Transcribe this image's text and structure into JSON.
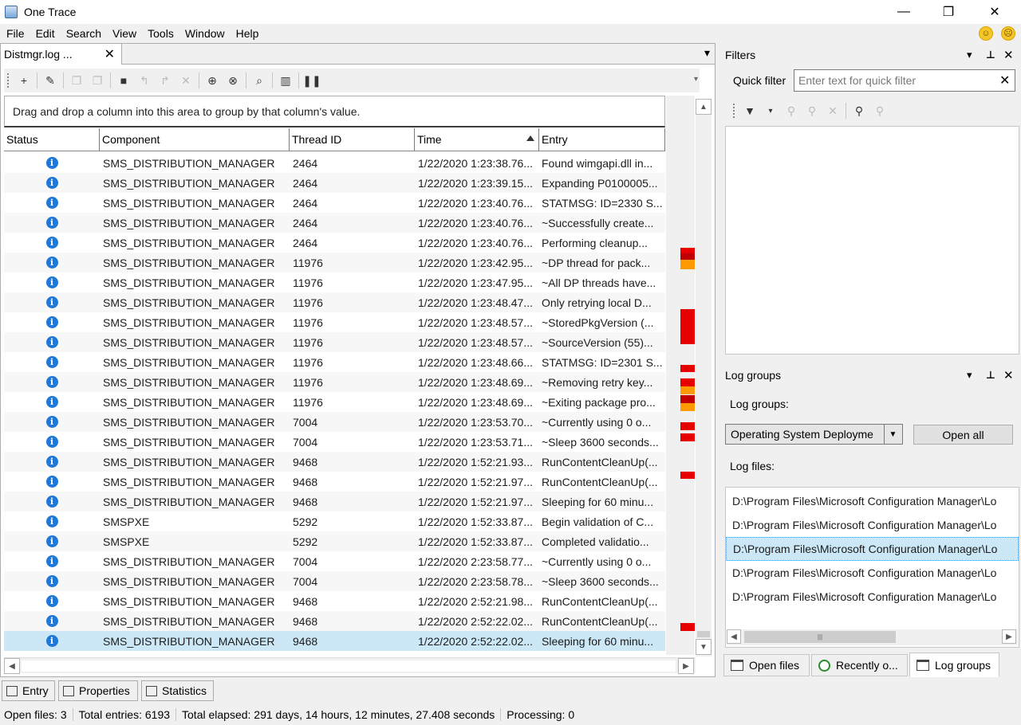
{
  "window": {
    "title": "One Trace",
    "minimize": "—",
    "maximize": "❐",
    "close": "✕"
  },
  "menu": [
    "File",
    "Edit",
    "Search",
    "View",
    "Tools",
    "Window",
    "Help"
  ],
  "document_tab": {
    "label": "Distmgr.log ...",
    "close": "✕"
  },
  "group_area_hint": "Drag and drop a column into this area to group by that column's value.",
  "columns": [
    "Status",
    "Component",
    "Thread ID",
    "Time",
    "Entry"
  ],
  "sorted_column": "Time",
  "rows": [
    {
      "component": "SMS_DISTRIBUTION_MANAGER",
      "thread": "2464",
      "time": "1/22/2020 1:23:38.76...",
      "entry": "Found wimgapi.dll in..."
    },
    {
      "component": "SMS_DISTRIBUTION_MANAGER",
      "thread": "2464",
      "time": "1/22/2020 1:23:39.15...",
      "entry": "Expanding P0100005..."
    },
    {
      "component": "SMS_DISTRIBUTION_MANAGER",
      "thread": "2464",
      "time": "1/22/2020 1:23:40.76...",
      "entry": "STATMSG: ID=2330 S..."
    },
    {
      "component": "SMS_DISTRIBUTION_MANAGER",
      "thread": "2464",
      "time": "1/22/2020 1:23:40.76...",
      "entry": "~Successfully create..."
    },
    {
      "component": "SMS_DISTRIBUTION_MANAGER",
      "thread": "2464",
      "time": "1/22/2020 1:23:40.76...",
      "entry": "Performing cleanup..."
    },
    {
      "component": "SMS_DISTRIBUTION_MANAGER",
      "thread": "11976",
      "time": "1/22/2020 1:23:42.95...",
      "entry": "~DP thread for pack..."
    },
    {
      "component": "SMS_DISTRIBUTION_MANAGER",
      "thread": "11976",
      "time": "1/22/2020 1:23:47.95...",
      "entry": "~All DP threads have..."
    },
    {
      "component": "SMS_DISTRIBUTION_MANAGER",
      "thread": "11976",
      "time": "1/22/2020 1:23:48.47...",
      "entry": "Only retrying local D..."
    },
    {
      "component": "SMS_DISTRIBUTION_MANAGER",
      "thread": "11976",
      "time": "1/22/2020 1:23:48.57...",
      "entry": "~StoredPkgVersion (..."
    },
    {
      "component": "SMS_DISTRIBUTION_MANAGER",
      "thread": "11976",
      "time": "1/22/2020 1:23:48.57...",
      "entry": "~SourceVersion (55)..."
    },
    {
      "component": "SMS_DISTRIBUTION_MANAGER",
      "thread": "11976",
      "time": "1/22/2020 1:23:48.66...",
      "entry": "STATMSG: ID=2301 S..."
    },
    {
      "component": "SMS_DISTRIBUTION_MANAGER",
      "thread": "11976",
      "time": "1/22/2020 1:23:48.69...",
      "entry": "~Removing retry key..."
    },
    {
      "component": "SMS_DISTRIBUTION_MANAGER",
      "thread": "11976",
      "time": "1/22/2020 1:23:48.69...",
      "entry": "~Exiting package pro..."
    },
    {
      "component": "SMS_DISTRIBUTION_MANAGER",
      "thread": "7004",
      "time": "1/22/2020 1:23:53.70...",
      "entry": "~Currently using 0 o..."
    },
    {
      "component": "SMS_DISTRIBUTION_MANAGER",
      "thread": "7004",
      "time": "1/22/2020 1:23:53.71...",
      "entry": "~Sleep 3600 seconds..."
    },
    {
      "component": "SMS_DISTRIBUTION_MANAGER",
      "thread": "9468",
      "time": "1/22/2020 1:52:21.93...",
      "entry": "RunContentCleanUp(..."
    },
    {
      "component": "SMS_DISTRIBUTION_MANAGER",
      "thread": "9468",
      "time": "1/22/2020 1:52:21.97...",
      "entry": "RunContentCleanUp(..."
    },
    {
      "component": "SMS_DISTRIBUTION_MANAGER",
      "thread": "9468",
      "time": "1/22/2020 1:52:21.97...",
      "entry": "Sleeping for 60 minu..."
    },
    {
      "component": "SMSPXE",
      "thread": "5292",
      "time": "1/22/2020 1:52:33.87...",
      "entry": "Begin validation of C..."
    },
    {
      "component": "SMSPXE",
      "thread": "5292",
      "time": "1/22/2020 1:52:33.87...",
      "entry": "Completed validatio..."
    },
    {
      "component": "SMS_DISTRIBUTION_MANAGER",
      "thread": "7004",
      "time": "1/22/2020 2:23:58.77...",
      "entry": "~Currently using 0 o..."
    },
    {
      "component": "SMS_DISTRIBUTION_MANAGER",
      "thread": "7004",
      "time": "1/22/2020 2:23:58.78...",
      "entry": "~Sleep 3600 seconds..."
    },
    {
      "component": "SMS_DISTRIBUTION_MANAGER",
      "thread": "9468",
      "time": "1/22/2020 2:52:21.98...",
      "entry": "RunContentCleanUp(..."
    },
    {
      "component": "SMS_DISTRIBUTION_MANAGER",
      "thread": "9468",
      "time": "1/22/2020 2:52:22.02...",
      "entry": "RunContentCleanUp(..."
    },
    {
      "component": "SMS_DISTRIBUTION_MANAGER",
      "thread": "9468",
      "time": "1/22/2020 2:52:22.02...",
      "entry": "Sleeping for 60 minu...",
      "selected": true
    }
  ],
  "heat_colors": {
    "red": "#e60000",
    "darkred": "#c00000",
    "orange": "#ff9900"
  },
  "filters": {
    "title": "Filters",
    "quick_filter_label": "Quick filter",
    "quick_filter_placeholder": "Enter text for quick filter"
  },
  "log_groups": {
    "title": "Log groups",
    "groups_label": "Log groups:",
    "selected_group": "Operating System Deployme",
    "open_all": "Open all",
    "files_label": "Log files:",
    "files": [
      "D:\\Program Files\\Microsoft Configuration Manager\\Lo",
      "D:\\Program Files\\Microsoft Configuration Manager\\Lo",
      "D:\\Program Files\\Microsoft Configuration Manager\\Lo",
      "D:\\Program Files\\Microsoft Configuration Manager\\Lo",
      "D:\\Program Files\\Microsoft Configuration Manager\\Lo"
    ],
    "selected_file_index": 2
  },
  "right_tabs": [
    "Open files",
    "Recently o...",
    "Log groups"
  ],
  "bottom_tabs": [
    "Entry",
    "Properties",
    "Statistics"
  ],
  "status": {
    "open_files": "Open files: 3",
    "total_entries": "Total entries: 6193",
    "elapsed": "Total elapsed: 291 days, 14 hours, 12 minutes, 27.408 seconds",
    "processing": "Processing: 0"
  }
}
